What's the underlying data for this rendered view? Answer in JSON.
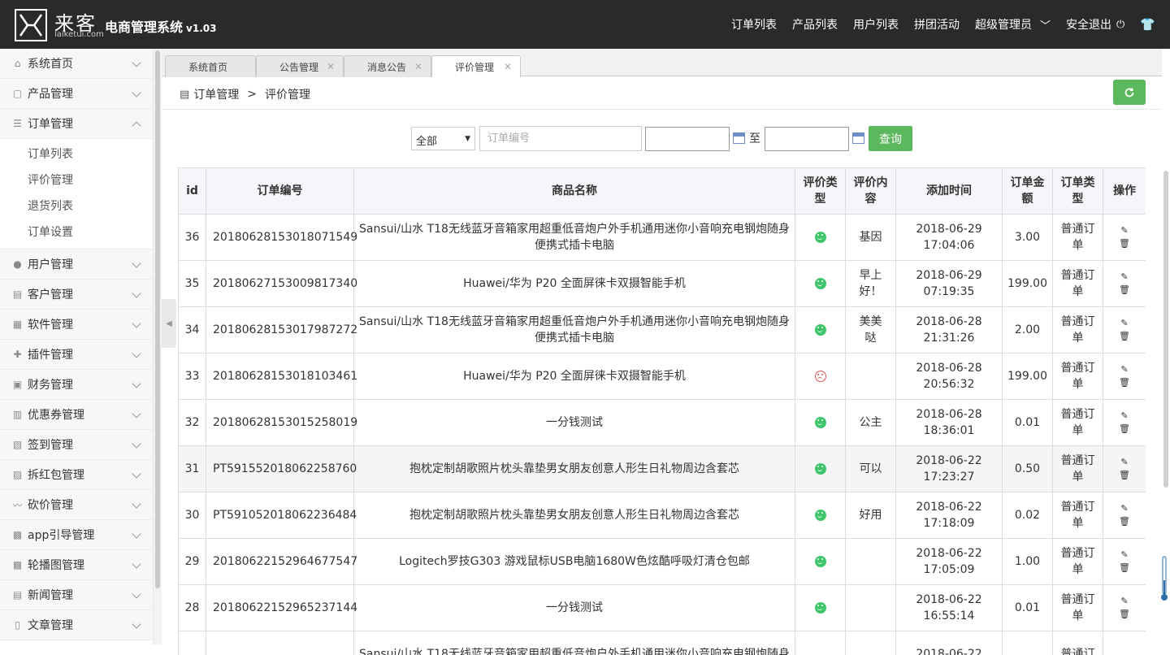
{
  "brand": {
    "logo_cn": "来客",
    "logo_en": "laiketui.com",
    "app_title": "电商管理系统",
    "version": "v1.03"
  },
  "topnav": {
    "items": [
      "订单列表",
      "产品列表",
      "用户列表",
      "拼团活动"
    ],
    "user": "超级管理员",
    "logout": "安全退出"
  },
  "sidebar": {
    "items": [
      {
        "label": "系统首页",
        "icon": "home-icon"
      },
      {
        "label": "产品管理",
        "icon": "bag-icon"
      },
      {
        "label": "订单管理",
        "icon": "list-icon",
        "expanded": true
      },
      {
        "label": "用户管理",
        "icon": "user-icon"
      },
      {
        "label": "客户管理",
        "icon": "doc-icon"
      },
      {
        "label": "软件管理",
        "icon": "grid-icon"
      },
      {
        "label": "插件管理",
        "icon": "puzzle-icon"
      },
      {
        "label": "财务管理",
        "icon": "car-icon"
      },
      {
        "label": "优惠券管理",
        "icon": "coupon-icon"
      },
      {
        "label": "签到管理",
        "icon": "clipboard-icon"
      },
      {
        "label": "拆红包管理",
        "icon": "envelope-icon"
      },
      {
        "label": "砍价管理",
        "icon": "bargain-icon"
      },
      {
        "label": "app引导管理",
        "icon": "image-icon"
      },
      {
        "label": "轮播图管理",
        "icon": "picture-icon"
      },
      {
        "label": "新闻管理",
        "icon": "news-icon"
      },
      {
        "label": "文章管理",
        "icon": "file-icon"
      }
    ],
    "sub_items": [
      "订单列表",
      "评价管理",
      "退货列表",
      "订单设置"
    ]
  },
  "tabs": [
    {
      "label": "系统首页",
      "closable": false
    },
    {
      "label": "公告管理",
      "closable": true
    },
    {
      "label": "消息公告",
      "closable": true
    },
    {
      "label": "评价管理",
      "closable": true,
      "active": true
    }
  ],
  "breadcrumb": {
    "parent": "订单管理",
    "sep": ">",
    "current": "评价管理"
  },
  "filter": {
    "select_value": "全部",
    "order_placeholder": "订单编号",
    "to_label": "至",
    "search_label": "查询"
  },
  "table": {
    "headers": [
      "id",
      "订单编号",
      "商品名称",
      "评价类型",
      "评价内容",
      "添加时间",
      "订单金额",
      "订单类型",
      "操作"
    ],
    "rows": [
      {
        "id": "36",
        "order": "20180628153018071549",
        "product": "Sansui/山水 T18无线蓝牙音箱家用超重低音炮户外手机通用迷你小音响充电钢炮随身便携式插卡电脑",
        "rating": "good",
        "content": "基因",
        "date": "2018-06-29",
        "time": "17:04:06",
        "amount": "3.00",
        "type": "普通订单"
      },
      {
        "id": "35",
        "order": "20180627153009817340",
        "product": "Huawei/华为 P20 全面屏徕卡双摄智能手机",
        "rating": "good",
        "content": "早上好！",
        "date": "2018-06-29",
        "time": "07:19:35",
        "amount": "199.00",
        "type": "普通订单"
      },
      {
        "id": "34",
        "order": "20180628153017987272",
        "product": "Sansui/山水 T18无线蓝牙音箱家用超重低音炮户外手机通用迷你小音响充电钢炮随身便携式插卡电脑",
        "rating": "good",
        "content": "美美哒",
        "date": "2018-06-28",
        "time": "21:31:26",
        "amount": "2.00",
        "type": "普通订单"
      },
      {
        "id": "33",
        "order": "20180628153018103461",
        "product": "Huawei/华为 P20 全面屏徕卡双摄智能手机",
        "rating": "bad",
        "content": "",
        "date": "2018-06-28",
        "time": "20:56:32",
        "amount": "199.00",
        "type": "普通订单"
      },
      {
        "id": "32",
        "order": "20180628153015258019",
        "product": "一分钱测试",
        "rating": "good",
        "content": "公主",
        "date": "2018-06-28",
        "time": "18:36:01",
        "amount": "0.01",
        "type": "普通订单"
      },
      {
        "id": "31",
        "order": "PT591552018062258760",
        "product": "抱枕定制胡歌照片枕头靠垫男女朋友创意人形生日礼物周边含套芯",
        "rating": "good",
        "content": "可以",
        "date": "2018-06-22",
        "time": "17:23:27",
        "amount": "0.50",
        "type": "普通订单",
        "highlight": true
      },
      {
        "id": "30",
        "order": "PT591052018062236484",
        "product": "抱枕定制胡歌照片枕头靠垫男女朋友创意人形生日礼物周边含套芯",
        "rating": "good",
        "content": "好用",
        "date": "2018-06-22",
        "time": "17:18:09",
        "amount": "0.02",
        "type": "普通订单"
      },
      {
        "id": "29",
        "order": "20180622152964677547",
        "product": "Logitech罗技G303 游戏鼠标USB电脑1680W色炫酷呼吸灯清仓包邮",
        "rating": "good",
        "content": "",
        "date": "2018-06-22",
        "time": "17:05:09",
        "amount": "1.00",
        "type": "普通订单"
      },
      {
        "id": "28",
        "order": "20180622152965237144",
        "product": "一分钱测试",
        "rating": "good",
        "content": "",
        "date": "2018-06-22",
        "time": "16:55:14",
        "amount": "0.01",
        "type": "普通订单"
      },
      {
        "id": "",
        "order": "",
        "product": "Sansui/山水 T18无线蓝牙音箱家用超重低音炮户外手机通用迷你小音响充电钢炮随身",
        "rating": "",
        "content": "",
        "date": "2018-06-22",
        "time": "",
        "amount": "",
        "type": "普通订"
      }
    ]
  },
  "colors": {
    "topbar": "#2a2a2a",
    "accent_green": "#5cb85c",
    "good_face": "#3fc56b",
    "bad_face": "#d9534f"
  }
}
